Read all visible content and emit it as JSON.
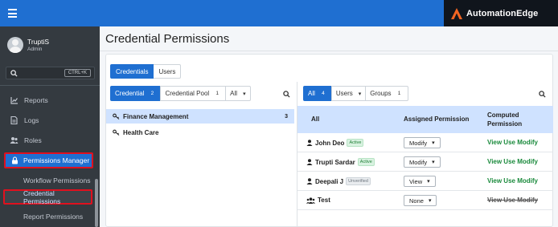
{
  "brand": {
    "name": "AutomationEdge",
    "accent": "#f26522"
  },
  "user": {
    "name": "TruptiS",
    "role": "Admin"
  },
  "search": {
    "shortcut": "CTRL+K"
  },
  "sidebar": {
    "items": [
      {
        "label": "Reports",
        "icon": "chart-line-icon"
      },
      {
        "label": "Logs",
        "icon": "file-icon"
      },
      {
        "label": "Roles",
        "icon": "users-icon"
      }
    ],
    "active": {
      "label": "Permissions Manager",
      "icon": "lock-icon"
    },
    "sub_items": [
      {
        "label": "Workflow Permissions"
      },
      {
        "label": "Credential Permissions",
        "active": true
      },
      {
        "label": "Report Permissions"
      }
    ]
  },
  "page": {
    "title": "Credential Permissions"
  },
  "tabs": [
    {
      "label": "Credentials",
      "active": true
    },
    {
      "label": "Users"
    }
  ],
  "left_filter": [
    {
      "label": "Credential",
      "count": "2",
      "active": true
    },
    {
      "label": "Credential Pool",
      "count": "1"
    },
    {
      "label": "All",
      "dropdown": true
    }
  ],
  "left_list": [
    {
      "name": "Finance Management",
      "count": "3",
      "selected": true
    },
    {
      "name": "Health Care",
      "count": ""
    }
  ],
  "right_filter": [
    {
      "label": "All",
      "count": "4",
      "active": true
    },
    {
      "label": "Users",
      "dropdown": true
    },
    {
      "label": "Groups",
      "count": "1"
    }
  ],
  "table": {
    "headers": {
      "name": "All",
      "assigned": "Assigned Permission",
      "computed_1": "Computed",
      "computed_2": "Permission"
    },
    "rows": [
      {
        "name": "John Deo",
        "status": "Active",
        "permission": "Modify",
        "computed": "View Use Modify",
        "type": "user"
      },
      {
        "name": "Trupti Sardar",
        "status": "Active",
        "permission": "Modify",
        "computed": "View Use Modify",
        "type": "user"
      },
      {
        "name": "Deepali J",
        "status": "Unverified",
        "permission": "View",
        "computed": "View Use Modify",
        "type": "user"
      },
      {
        "name": "Test",
        "status": "",
        "permission": "None",
        "computed": "View Use Modify",
        "type": "group",
        "struck": true
      }
    ]
  }
}
